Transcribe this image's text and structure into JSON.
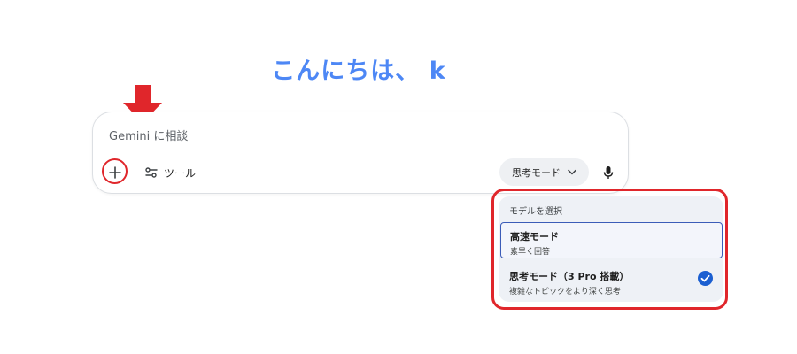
{
  "greeting": "こんにちは、 k",
  "prompt": {
    "placeholder": "Gemini に相談",
    "add_icon": "plus-icon",
    "tools_label": "ツール",
    "tools_icon": "tune-icon",
    "mode_label": "思考モード",
    "mode_icon": "chevron-down-icon",
    "mic_icon": "mic-icon"
  },
  "mode_menu": {
    "header": "モデルを選択",
    "items": [
      {
        "title": "高速モード",
        "subtitle": "素早く回答",
        "selected": false
      },
      {
        "title": "思考モード（3 Pro 搭載）",
        "subtitle": "複雑なトピックをより深く思考",
        "selected": true
      }
    ]
  },
  "colors": {
    "greeting": "#4d87f5",
    "annotation": "#e0262b",
    "check": "#1b5fd1",
    "menu_bg": "#eef1f6"
  }
}
